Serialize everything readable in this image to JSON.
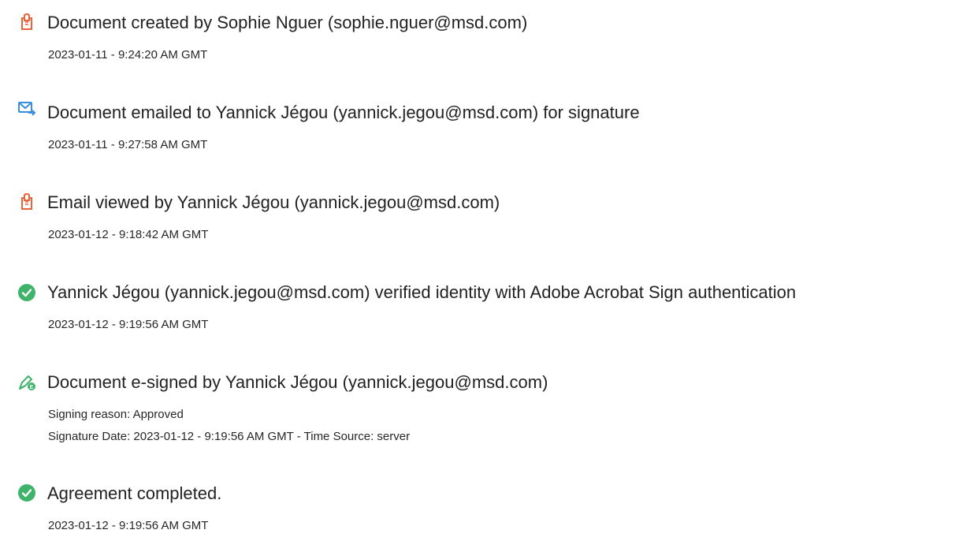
{
  "events": [
    {
      "icon": "document-created-icon",
      "title": "Document created by Sophie Nguer (sophie.nguer@msd.com)",
      "lines": [
        "2023-01-11 - 9:24:20 AM GMT"
      ]
    },
    {
      "icon": "email-sent-icon",
      "title": "Document emailed to Yannick Jégou (yannick.jegou@msd.com) for signature",
      "lines": [
        "2023-01-11 - 9:27:58 AM GMT"
      ]
    },
    {
      "icon": "document-viewed-icon",
      "title": "Email viewed by Yannick Jégou (yannick.jegou@msd.com)",
      "lines": [
        "2023-01-12 - 9:18:42 AM GMT"
      ]
    },
    {
      "icon": "check-circle-icon",
      "title": "Yannick Jégou (yannick.jegou@msd.com) verified identity with Adobe Acrobat Sign authentication",
      "lines": [
        "2023-01-12 - 9:19:56 AM GMT"
      ]
    },
    {
      "icon": "esign-pen-icon",
      "title": "Document e-signed by Yannick Jégou (yannick.jegou@msd.com)",
      "lines": [
        "Signing reason: Approved",
        "Signature Date: 2023-01-12 - 9:19:56 AM GMT - Time Source: server"
      ]
    },
    {
      "icon": "check-circle-icon",
      "title": "Agreement completed.",
      "lines": [
        "2023-01-12 - 9:19:56 AM GMT"
      ]
    }
  ],
  "colors": {
    "document_icon": "#e8623a",
    "email_icon": "#3a8ee0",
    "check_icon": "#3fb36a",
    "esign_icon": "#3fb36a"
  }
}
